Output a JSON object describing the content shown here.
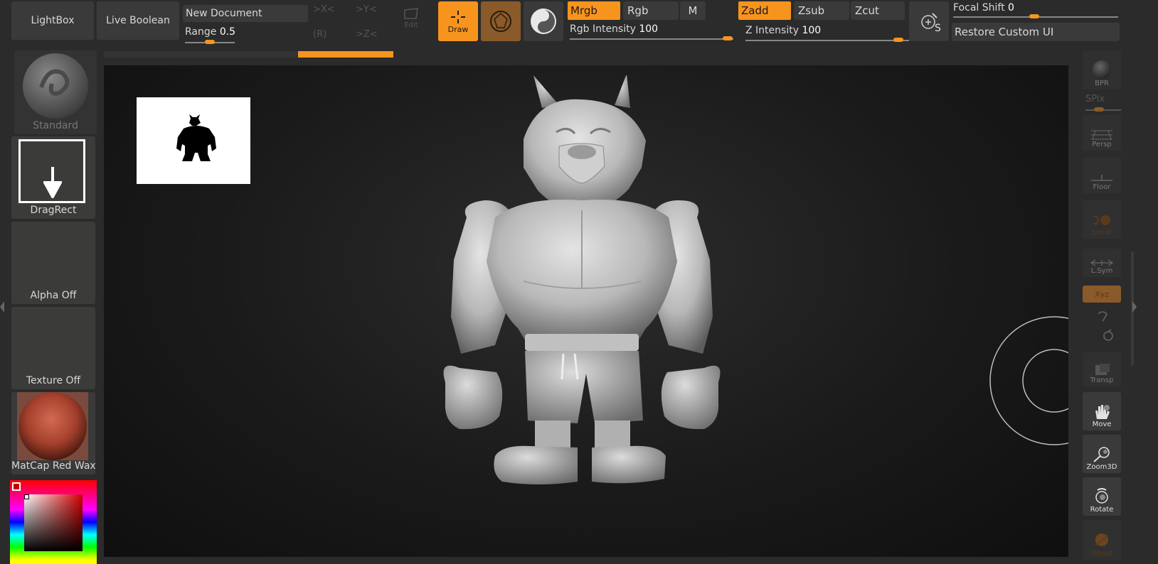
{
  "toolbar": {
    "lightbox": "LightBox",
    "live_boolean": "Live Boolean",
    "new_document": "New Document",
    "range_label": "Range",
    "range_value": "0.5",
    "x_mirror": ">X<",
    "y_mirror": ">Y<",
    "z_mirror": ">Z<",
    "r_label": "(R)",
    "edit": "Edit",
    "draw": "Draw",
    "mrgb": "Mrgb",
    "rgb": "Rgb",
    "m": "M",
    "rgb_intensity_label": "Rgb Intensity",
    "rgb_intensity_value": "100",
    "zadd": "Zadd",
    "zsub": "Zsub",
    "zcut": "Zcut",
    "z_intensity_label": "Z Intensity",
    "z_intensity_value": "100",
    "s_label": "S",
    "focal_shift_label": "Focal Shift",
    "focal_shift_value": "0",
    "restore_custom_ui": "Restore Custom UI"
  },
  "left_panel": {
    "brush": "Standard",
    "stroke": "DragRect",
    "alpha": "Alpha Off",
    "texture": "Texture Off",
    "material": "MatCap Red Wax"
  },
  "right_panel": {
    "bpr": "BPR",
    "spix": "SPix",
    "persp": "Persp",
    "floor": "Floor",
    "local": "Local",
    "lsym": "L.Sym",
    "xyz": "Xyz",
    "transp": "Transp",
    "move": "Move",
    "zoom3d": "Zoom3D",
    "rotate": "Rotate",
    "ghost": "Ghost"
  },
  "colors": {
    "accent": "#f7941e",
    "background": "#2b2b2b",
    "canvas": "#1a1a1a",
    "material": "#a3402c"
  }
}
